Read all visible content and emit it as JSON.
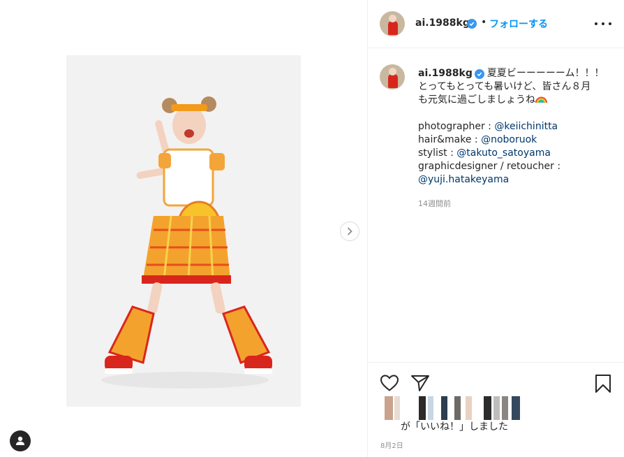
{
  "post": {
    "username": "ai.1988kg",
    "follow_label": "フォローする",
    "separator": "•",
    "caption_lines": [
      "夏夏ビーーーーーム！！！",
      "とってもとっても暑いけど、皆さん８月",
      "も元気に過ごしましょうね"
    ],
    "credits": {
      "photographer_label": "photographer : ",
      "photographer": "@keiichinitta",
      "hair_label": "hair&make : ",
      "hair": "@noboruok",
      "stylist_label": "stylist : ",
      "stylist": "@takuto_satoyama",
      "designer_label": "graphicdesigner / retoucher :",
      "designer": "@yuji.hatakeyama"
    },
    "time_ago": "14週間前",
    "liked_text": "が「いいね！」しました",
    "date": "8月2日"
  },
  "colors": {
    "link": "#00376b",
    "follow": "#0095f6",
    "verified": "#3897f0",
    "muted": "#8e8e8e"
  },
  "icons": {
    "like": "heart-icon",
    "share": "paper-plane-icon",
    "save": "bookmark-icon",
    "more": "ellipsis-icon",
    "next": "chevron-right-icon",
    "tags": "user-tag-icon",
    "verified": "verified-badge-icon",
    "emoji": "rainbow-emoji"
  }
}
